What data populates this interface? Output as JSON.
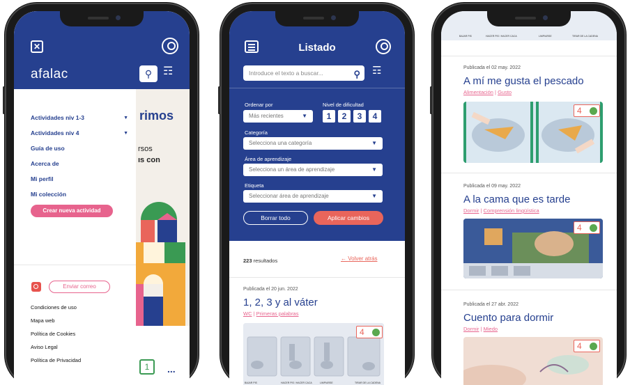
{
  "phone1": {
    "logo": "afalac",
    "close_icon": "close-icon",
    "menu_items": [
      {
        "label": "Actividades niv 1-3",
        "has_caret": true
      },
      {
        "label": "Actividades niv 4",
        "has_caret": true
      },
      {
        "label": "Guía de uso",
        "has_caret": false
      },
      {
        "label": "Acerca de",
        "has_caret": false
      },
      {
        "label": "Mi perfil",
        "has_caret": false
      },
      {
        "label": "Mi colección",
        "has_caret": false
      }
    ],
    "create_button": "Crear nueva actividad",
    "mail_button": "Enviar correo",
    "footer_links": [
      "Condiciones de uso",
      "Mapa web",
      "Política de Cookies",
      "Aviso Legal",
      "Política de Privacidad"
    ],
    "bg_title": "rimos",
    "bg_line1": "rsos",
    "bg_line2": "ıs con",
    "bg_pager": "1",
    "bg_dots": "..."
  },
  "phone2": {
    "title": "Listado",
    "search_placeholder": "Introduce el texto a buscar...",
    "order_label": "Ordenar por",
    "order_value": "Más recientes",
    "difficulty_label": "Nivel de dificultad",
    "levels": [
      "1",
      "2",
      "3",
      "4"
    ],
    "category_label": "Categoría",
    "category_placeholder": "Selecciona una categoría",
    "area_label": "Área de aprendizaje",
    "area_placeholder": "Selecciona un área de aprendizaje",
    "tag_label": "Etiqueta",
    "tag_placeholder": "Seleccionar área de aprendizaje",
    "clear_button": "Borrar todo",
    "apply_button": "Aplicar cambios",
    "results_count": "223",
    "results_suffix": " resultados",
    "back_link": "Volver atrás",
    "card": {
      "published": "Publicada el 20 jun. 2022",
      "title": "1, 2, 3 y al váter",
      "tags": [
        "WC",
        "Primeras palabras"
      ],
      "level": "4",
      "strip_labels": [
        "BAJAR PIS",
        "HACER PIS / HACER CACA",
        "LIMPIARSE",
        "TIRAR DE LA CADENA"
      ]
    }
  },
  "phone3": {
    "strip_labels": [
      "BAJAR PIS",
      "HACER PIS / HACER CACA",
      "LIMPIARSE",
      "TIRAR DE LA CADENA"
    ],
    "cards": [
      {
        "published": "Publicada el 02 may. 2022",
        "title": "A mí me gusta el pescado",
        "tags": [
          "Alimentación",
          "Gusto"
        ],
        "level": "4"
      },
      {
        "published": "Publicada el 09 may. 2022",
        "title": "A la cama que es tarde",
        "tags": [
          "Dormir",
          "Comprensión lingüística"
        ],
        "level": "4"
      },
      {
        "published": "Publicada el 27 abr. 2022",
        "title": "Cuento para dormir",
        "tags": [
          "Dormir",
          "Miedo"
        ],
        "level": "4"
      }
    ]
  },
  "colors": {
    "primary": "#26408f",
    "pink": "#e7638d",
    "coral": "#e9655b",
    "green": "#3a9a53"
  }
}
